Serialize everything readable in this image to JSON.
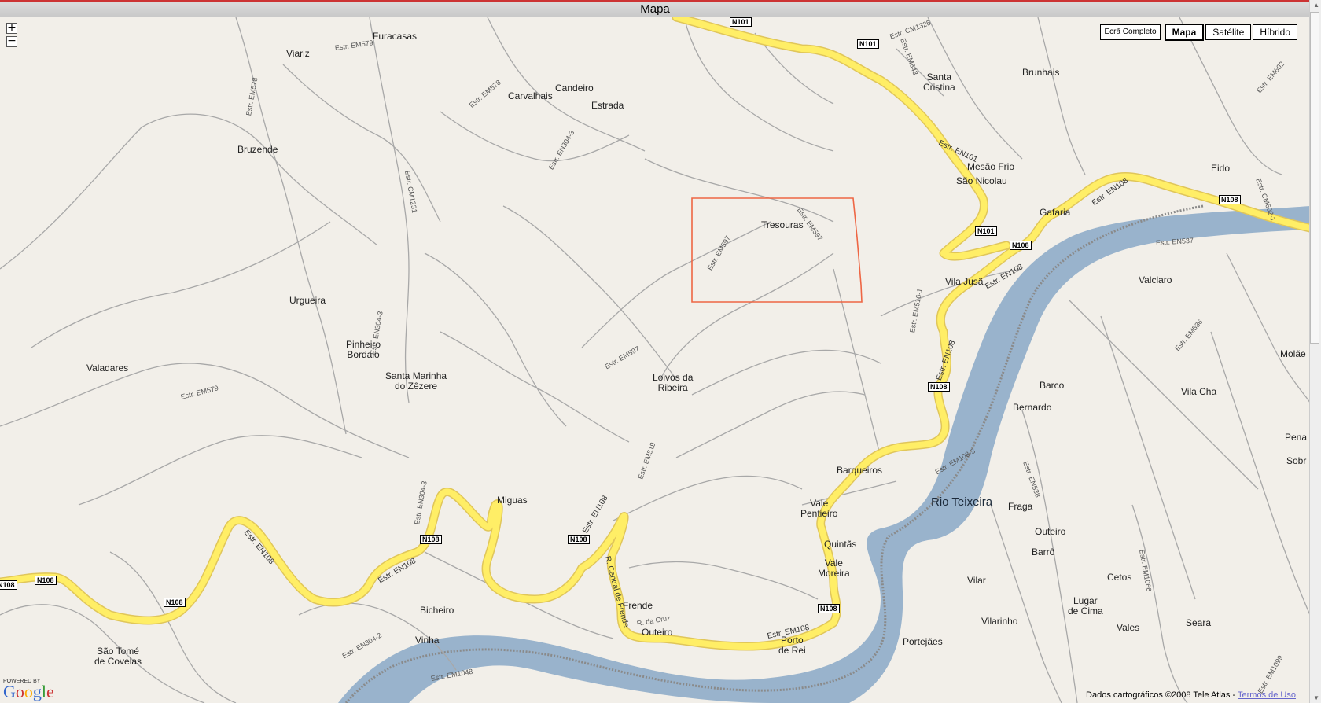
{
  "window": {
    "title": "Mapa"
  },
  "controls": {
    "zoom_in": "+",
    "zoom_out": "−"
  },
  "map_types": {
    "fullscreen": "Ecrã Completo",
    "map": "Mapa",
    "satellite": "Satélite",
    "hybrid": "Híbrido"
  },
  "towns": {
    "viariz": "Viariz",
    "furacasas": "Furacasas",
    "candeiro": "Candeiro",
    "carvalhais": "Carvalhais",
    "estrada": "Estrada",
    "bruzende": "Bruzende",
    "santa_cristina": "Santa\nCristina",
    "brunhais": "Brunhais",
    "mesao_frio": "Mesão Frio",
    "sao_nicolau": "São Nicolau",
    "eido": "Eido",
    "gafaria": "Gafaria",
    "tresouras": "Tresouras",
    "vila_jusa": "Vila Jusã",
    "urgueira": "Urgueira",
    "valclaro": "Valclaro",
    "pinheiro_bordalo": "Pinheiro\nBordalo",
    "valadares": "Valadares",
    "santa_marinha": "Santa Marinha\ndo Zêzere",
    "loivos": "Loivos da\nRibeira",
    "barco": "Barco",
    "bernardo": "Bernardo",
    "vila_cha": "Vila Cha",
    "molaes": "Molãe",
    "barqueiros": "Barqueiros",
    "vale_pentieiro": "Vale\nPentieiro",
    "miguas": "Miguas",
    "fraga": "Fraga",
    "quintas": "Quintãs",
    "outeiro_r": "Outeiro",
    "vale_moreira": "Vale\nMoreira",
    "barro": "Barrô",
    "cetos": "Cetos",
    "vilar": "Vilar",
    "lugar_de_cima": "Lugar\nde Cima",
    "frende": "Frende",
    "bicheiro": "Bicheiro",
    "outeiro": "Outeiro",
    "vilarinho": "Vilarinho",
    "vales": "Vales",
    "seara": "Seara",
    "vinha": "Vinha",
    "porto_de_rei": "Porto\nde Rei",
    "portejaes": "Portejães",
    "sao_tome": "São Tomé\nde Covelas",
    "pena": "Pena",
    "sobr": "Sobr"
  },
  "river": {
    "name": "Rio Teixeira"
  },
  "shields": {
    "n101a": "N101",
    "n101b": "N101",
    "n101c": "N101",
    "n108a": "N108",
    "n108b": "N108",
    "n108c": "N108",
    "n108d": "N108",
    "n108e": "N108",
    "n108f": "N108",
    "n108g": "N108",
    "n108h": "N108",
    "n108i": "N108"
  },
  "road_labels": {
    "em579": "Estr. EM579",
    "em578": "Estr. EM578",
    "em578b": "Estr. EM578",
    "en3043": "Estr. EN304-3",
    "cm1231": "Estr. CM1231",
    "cm1325": "Estr. CM1325",
    "em643": "Estr. EM643",
    "em597": "Estr. EM597",
    "em597b": "Estr. EM597",
    "em597c": "Estr. EM597",
    "en537": "Estr. EN537",
    "em5161": "Estr. EM516-1",
    "em519": "Estr. EM519",
    "em1083": "Estr. EM108-3",
    "en3042": "Estr. EN304-2",
    "em1048": "Estr. EM1048",
    "em1066": "Estr. EM1066",
    "em1099": "Estr. EM1099",
    "em536": "Estr. EM536",
    "en538": "Estr. EN538",
    "em579b": "Estr. EM579",
    "en3043b": "Estr. EN304-3",
    "en3043c": "Estr. EN304-3",
    "em6021": "Estr. CM602-1",
    "em602": "Estr. EM602",
    "rdacruz": "R. da Cruz"
  },
  "yellow_labels": {
    "en101": "Estr. EN101",
    "en108a": "Estr. EN108",
    "en108b": "Estr. EN108",
    "en108c": "Estr. EN108",
    "en108d": "Estr. EN108",
    "en108e": "Estr. EN108",
    "em108": "Estr. EM108",
    "central": "R. Central de Frende"
  },
  "attribution": {
    "text": "Dados cartográficos ©2008 Tele Atlas - ",
    "link": "Termos de Uso"
  },
  "logo": {
    "powered": "POWERED BY",
    "word": "Google"
  },
  "colors": {
    "background": "#f2efe9",
    "road": "#a8a8a8",
    "highway": "#ffee66",
    "water": "#99b3cc",
    "selection": "#ee6644"
  }
}
